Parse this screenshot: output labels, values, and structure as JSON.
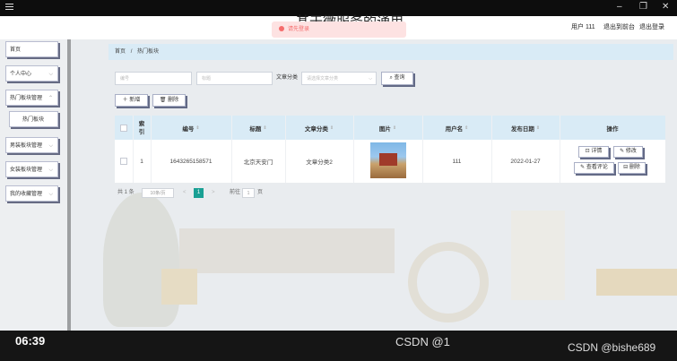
{
  "window": {
    "menu_icon": "hamburger-icon",
    "min": "–",
    "restore": "❐",
    "close": "✕"
  },
  "site_title": "基于微服务的通用",
  "toast": {
    "text": "请先登录",
    "color": "#f56c6c"
  },
  "header": {
    "user": "用户 111",
    "back_front": "退出到前台",
    "logout": "退出登录"
  },
  "sidebar": {
    "items": [
      {
        "label": "首页"
      },
      {
        "label": "个人中心"
      },
      {
        "label": "热门板块管理"
      },
      {
        "label": "热门板块"
      },
      {
        "label": "男装板块管理"
      },
      {
        "label": "女装板块管理"
      },
      {
        "label": "我的收藏管理"
      }
    ]
  },
  "breadcrumb": {
    "home": "首页",
    "sep": "/",
    "current": "热门板块"
  },
  "search": {
    "no_placeholder": "编号",
    "title_placeholder": "标题",
    "category_label": "文章分类",
    "category_placeholder": "请选择文章分类",
    "query_label": "查询"
  },
  "actions": {
    "add": "新增",
    "delete": "删除"
  },
  "table": {
    "headers": [
      "索引",
      "编号",
      "标题",
      "文章分类",
      "图片",
      "用户名",
      "发布日期",
      "操作"
    ],
    "rows": [
      {
        "index": "1",
        "no": "1643265158571",
        "title": "北京天安门",
        "category": "文章分类2",
        "user": "111",
        "date": "2022-01-27",
        "ops": [
          "详情",
          "修改",
          "查看评论",
          "删除"
        ]
      }
    ]
  },
  "pagination": {
    "total": "共 1 条",
    "page_size": "10条/页",
    "prev": "<",
    "page": "1",
    "next": ">",
    "goto": "前往",
    "goto_page": "1",
    "suffix": "页"
  },
  "video": {
    "time": "06:39",
    "watermark_center": "CSDN @1",
    "watermark_right": "CSDN @bishe689"
  },
  "colors": {
    "accent": "#1aa094",
    "header_bg": "#d9ebf6"
  }
}
